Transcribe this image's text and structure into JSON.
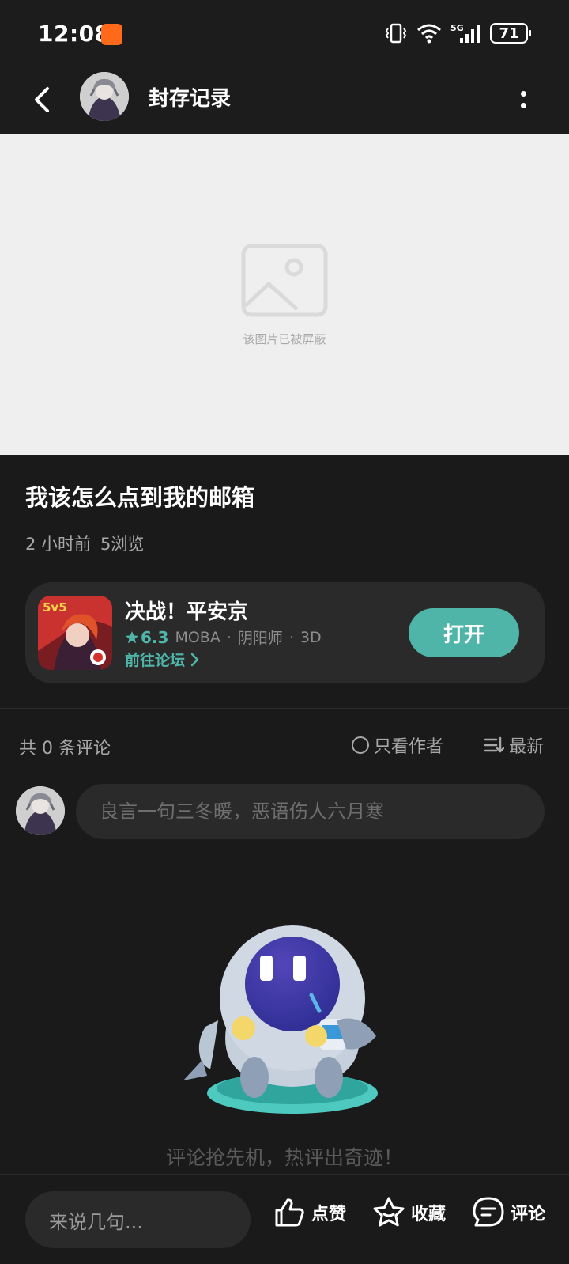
{
  "status_bar": {
    "time": "12:08",
    "battery": "71",
    "network": "5G"
  },
  "header": {
    "title": "封存记录"
  },
  "blocked_image": {
    "text": "该图片已被屏蔽"
  },
  "post": {
    "title": "我该怎么点到我的邮箱",
    "time_ago": "2 小时前",
    "views": "5浏览"
  },
  "game": {
    "name": "决战！平安京",
    "rating": "6.3",
    "tag1": "MOBA",
    "tag2": "阴阳师",
    "tag3": "3D",
    "forum_link": "前往论坛",
    "open_button": "打开"
  },
  "comments": {
    "count_label": "共 0 条评论",
    "author_only": "只看作者",
    "sort": "最新",
    "input_placeholder": "良言一句三冬暖，恶语伤人六月寒",
    "empty_text": "评论抢先机，热评出奇迹！"
  },
  "bottom_bar": {
    "input_placeholder": "来说几句...",
    "like": "点赞",
    "favorite": "收藏",
    "comment": "评论"
  },
  "colors": {
    "accent": "#4fb5a8",
    "background": "#1a1a1a",
    "card": "#2a2a2a"
  }
}
